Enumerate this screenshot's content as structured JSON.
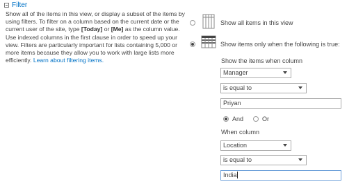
{
  "section": {
    "title": "Filter",
    "description": {
      "part1": "Show all of the items in this view, or display a subset of the items by using filters. To filter on a column based on the current date or the current user of the site, type ",
      "today": "[Today]",
      "or": " or ",
      "me": "[Me]",
      "part2": " as the column value. Use indexed columns in the first clause in order to speed up your view. Filters are particularly important for lists containing 5,000 or more items because they allow you to work with large lists more efficiently. ",
      "link": "Learn about filtering items."
    }
  },
  "options": {
    "show_all": {
      "label": "Show all items in this view",
      "selected": false,
      "icon": "table-icon"
    },
    "show_filtered": {
      "label": "Show items only when the following is true:",
      "selected": true,
      "icon": "filtered-table-icon"
    }
  },
  "clause1": {
    "heading": "Show the items when column",
    "column": "Manager",
    "operator": "is equal to",
    "value": "Priyan"
  },
  "connector": {
    "and_label": "And",
    "or_label": "Or",
    "selected": "And"
  },
  "clause2": {
    "heading": "When column",
    "column": "Location",
    "operator": "is equal to",
    "value": "India"
  }
}
